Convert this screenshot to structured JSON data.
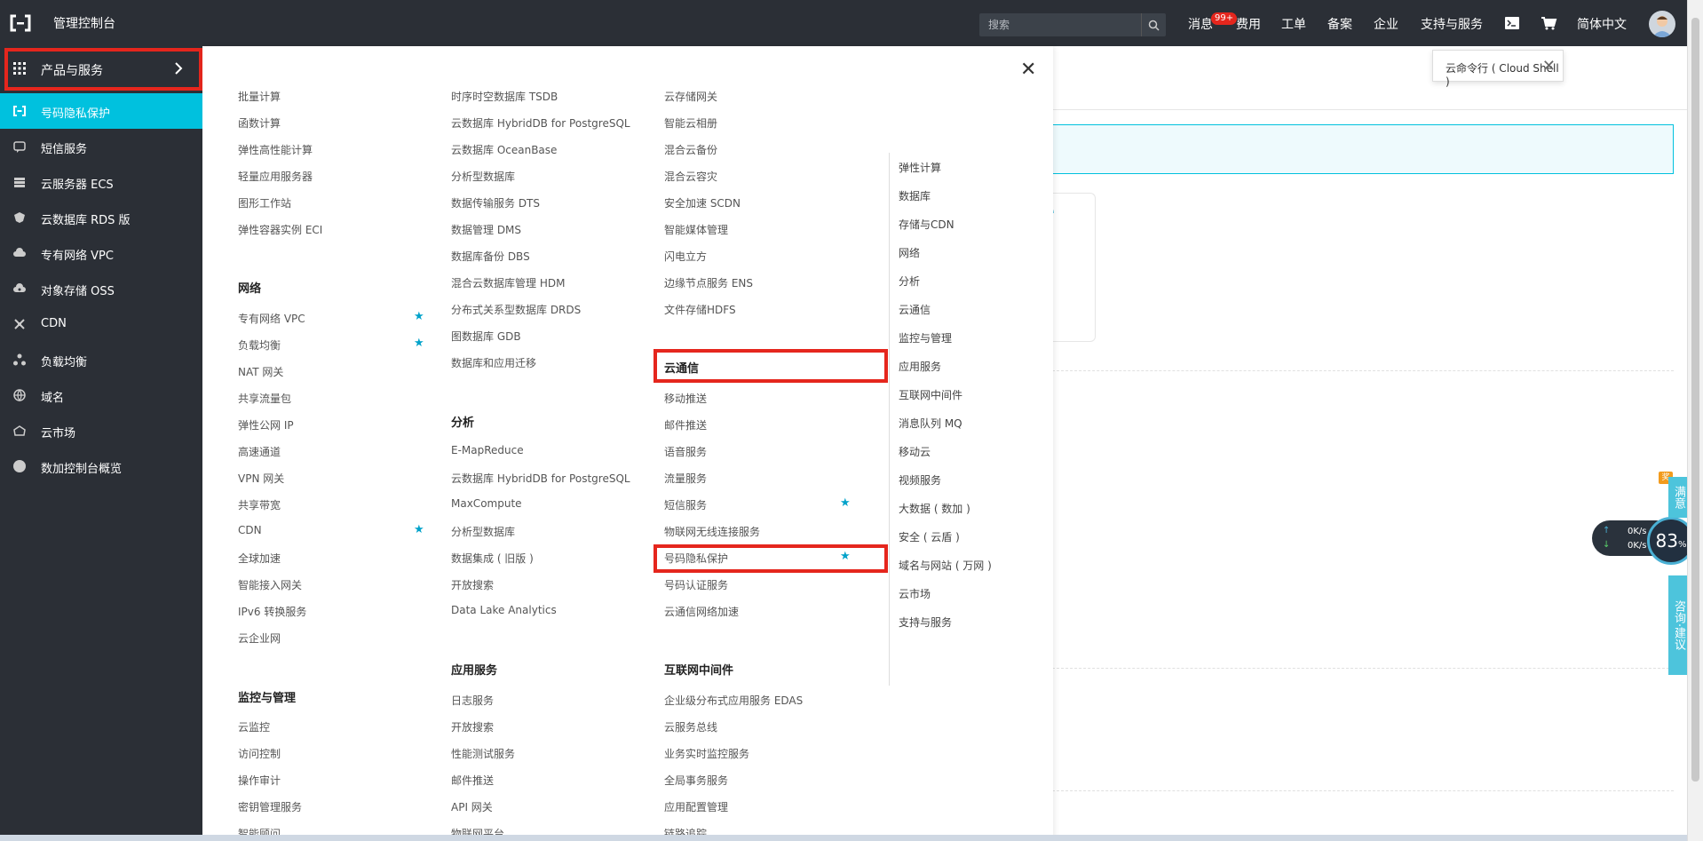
{
  "topbar": {
    "title": "管理控制台",
    "search_placeholder": "搜索",
    "nav": [
      "消息",
      "费用",
      "工单",
      "备案",
      "企业",
      "支持与服务",
      "简体中文"
    ],
    "badge": "99+",
    "icons": [
      "terminal-icon",
      "cart-icon"
    ]
  },
  "sidebar": {
    "header": "产品与服务",
    "items": [
      {
        "label": "号码隐私保护",
        "icon": "privacy-icon",
        "active": true
      },
      {
        "label": "短信服务",
        "icon": "sms-icon"
      },
      {
        "label": "云服务器 ECS",
        "icon": "server-icon"
      },
      {
        "label": "云数据库 RDS 版",
        "icon": "database-icon"
      },
      {
        "label": "专有网络 VPC",
        "icon": "cloud-network-icon"
      },
      {
        "label": "对象存储 OSS",
        "icon": "storage-icon"
      },
      {
        "label": "CDN",
        "icon": "cdn-icon"
      },
      {
        "label": "负载均衡",
        "icon": "load-balance-icon"
      },
      {
        "label": "域名",
        "icon": "globe-icon"
      },
      {
        "label": "云市场",
        "icon": "market-icon"
      },
      {
        "label": "数加控制台概览",
        "icon": "circle-icon"
      }
    ]
  },
  "cloudshell": {
    "label": "云命令行 ( Cloud Shell )"
  },
  "panel": {
    "col1": {
      "items": [
        "批量计算",
        "函数计算",
        "弹性高性能计算",
        "轻量应用服务器",
        "图形工作站",
        "弹性容器实例 ECI"
      ],
      "network_title": "网络",
      "network": [
        "专有网络 VPC",
        "负载均衡",
        "NAT 网关",
        "共享流量包",
        "弹性公网 IP",
        "高速通道",
        "VPN 网关",
        "共享带宽",
        "CDN",
        "全球加速",
        "智能接入网关",
        "IPv6 转换服务",
        "云企业网"
      ],
      "monitor_title": "监控与管理",
      "monitor": [
        "云监控",
        "访问控制",
        "操作审计",
        "密钥管理服务",
        "智能顾问"
      ]
    },
    "col2": {
      "items": [
        "时序时空数据库 TSDB",
        "云数据库 HybridDB for PostgreSQL",
        "云数据库 OceanBase",
        "分析型数据库",
        "数据传输服务 DTS",
        "数据管理 DMS",
        "数据库备份 DBS",
        "混合云数据库管理 HDM",
        "分布式关系型数据库 DRDS",
        "图数据库 GDB",
        "数据库和应用迁移"
      ],
      "analysis_title": "分析",
      "analysis": [
        "E-MapReduce",
        "云数据库 HybridDB for PostgreSQL",
        "MaxCompute",
        "分析型数据库",
        "数据集成 ( 旧版 )",
        "开放搜索",
        "Data Lake Analytics"
      ],
      "app_title": "应用服务",
      "app": [
        "日志服务",
        "开放搜索",
        "性能测试服务",
        "邮件推送",
        "API 网关",
        "物联网平台"
      ]
    },
    "col3": {
      "items": [
        "云存储网关",
        "智能云相册",
        "混合云备份",
        "混合云容灾",
        "安全加速 SCDN",
        "智能媒体管理",
        "闪电立方",
        "边缘节点服务 ENS",
        "文件存储HDFS"
      ],
      "comm_title": "云通信",
      "comm": [
        "移动推送",
        "邮件推送",
        "语音服务",
        "流量服务",
        "短信服务",
        "物联网无线连接服务",
        "号码隐私保护",
        "号码认证服务",
        "云通信网络加速"
      ],
      "middleware_title": "互联网中间件",
      "middleware": [
        "企业级分布式应用服务 EDAS",
        "云服务总线",
        "业务实时监控服务",
        "全局事务服务",
        "应用配置管理",
        "链路追踪"
      ]
    },
    "categories": [
      "弹性计算",
      "数据库",
      "存储与CDN",
      "网络",
      "分析",
      "云通信",
      "监控与管理",
      "应用服务",
      "互联网中间件",
      "消息队列 MQ",
      "移动云",
      "视频服务",
      "大数据 ( 数加 )",
      "安全 ( 云盾 )",
      "域名与网站 ( 万网 )",
      "云市场",
      "支持与服务"
    ]
  },
  "widgets": {
    "up_speed": "0K/s",
    "down_speed": "0K/s",
    "gauge": "83",
    "gauge_unit": "%",
    "reward": "奖",
    "tab1": "满意",
    "tab2": "咨询·建议"
  },
  "colors": {
    "topbar": "#2b2f36",
    "accent": "#00c1de",
    "highlight": "#e5261d",
    "star": "#00a2ca"
  }
}
